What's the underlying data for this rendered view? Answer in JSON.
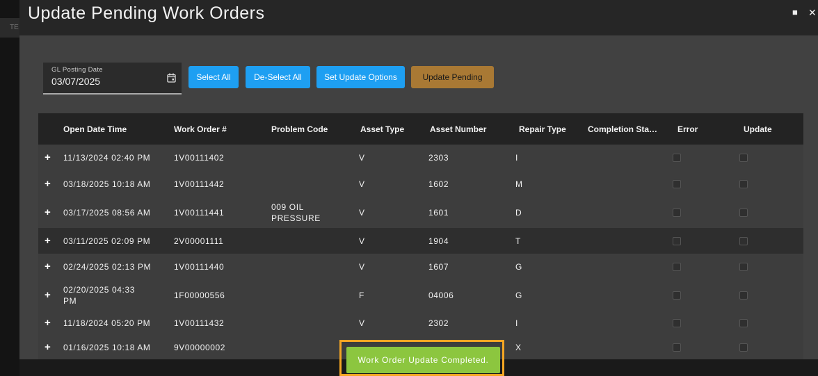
{
  "background": {
    "tab_label": "TE"
  },
  "dialog": {
    "title": "Update Pending Work Orders",
    "maximize_icon": "square-icon",
    "close_icon": "close-icon"
  },
  "toolbar": {
    "date_label": "GL Posting Date",
    "date_value": "03/07/2025",
    "calendar_icon": "calendar-icon",
    "select_all": "Select All",
    "deselect_all": "De-Select All",
    "set_update_options": "Set Update Options",
    "update_pending": "Update Pending"
  },
  "table": {
    "columns": [
      "Open Date Time",
      "Work Order #",
      "Problem Code",
      "Asset Type",
      "Asset Number",
      "Repair Type",
      "Completion Sta…",
      "Error",
      "Update"
    ],
    "rows": [
      {
        "open": "11/13/2024 02:40 PM",
        "wo": "1V00111402",
        "problem": "",
        "asset_type": "V",
        "asset_number": "2303",
        "repair": "I",
        "completion": ""
      },
      {
        "open": "03/18/2025 10:18 AM",
        "wo": "1V00111442",
        "problem": "",
        "asset_type": "V",
        "asset_number": "1602",
        "repair": "M",
        "completion": ""
      },
      {
        "open": "03/17/2025 08:56 AM",
        "wo": "1V00111441",
        "problem": "009 OIL\nPRESSURE",
        "asset_type": "V",
        "asset_number": "1601",
        "repair": "D",
        "completion": ""
      },
      {
        "open": "03/11/2025 02:09 PM",
        "wo": "2V00001111",
        "problem": "",
        "asset_type": "V",
        "asset_number": "1904",
        "repair": "T",
        "completion": ""
      },
      {
        "open": "02/24/2025 02:13 PM",
        "wo": "1V00111440",
        "problem": "",
        "asset_type": "V",
        "asset_number": "1607",
        "repair": "G",
        "completion": ""
      },
      {
        "open": "02/20/2025 04:33\nPM",
        "wo": "1F00000556",
        "problem": "",
        "asset_type": "F",
        "asset_number": "04006",
        "repair": "G",
        "completion": ""
      },
      {
        "open": "11/18/2024 05:20 PM",
        "wo": "1V00111432",
        "problem": "",
        "asset_type": "V",
        "asset_number": "2302",
        "repair": "I",
        "completion": ""
      },
      {
        "open": "01/16/2025 10:18 AM",
        "wo": "9V00000002",
        "problem": "",
        "asset_type": "",
        "asset_number": "",
        "repair": "X",
        "completion": ""
      }
    ],
    "expand_symbol": "+"
  },
  "toast": {
    "message": "Work Order Update Completed."
  }
}
